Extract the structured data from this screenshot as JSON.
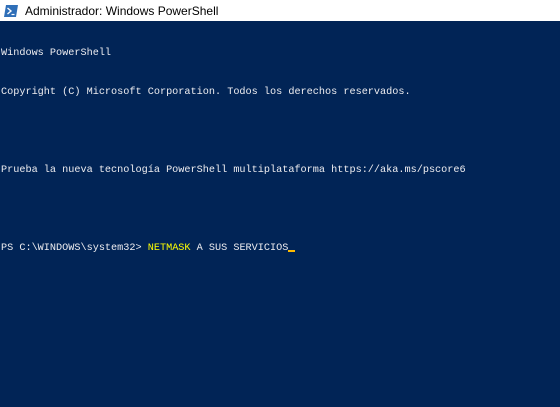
{
  "window": {
    "title": "Administrador: Windows PowerShell",
    "icon": "powershell-icon"
  },
  "console": {
    "header_line_1": "Windows PowerShell",
    "header_line_2": "Copyright (C) Microsoft Corporation. Todos los derechos reservados.",
    "info_line": "Prueba la nueva tecnología PowerShell multiplataforma https://aka.ms/pscore6",
    "prompt": "PS C:\\WINDOWS\\system32> ",
    "command": "NETMASK",
    "arguments": " A SUS SERVICIOS",
    "colors": {
      "background": "#012456",
      "text": "#eeedf0",
      "command": "#ffff00",
      "cursor": "#feba01"
    }
  }
}
